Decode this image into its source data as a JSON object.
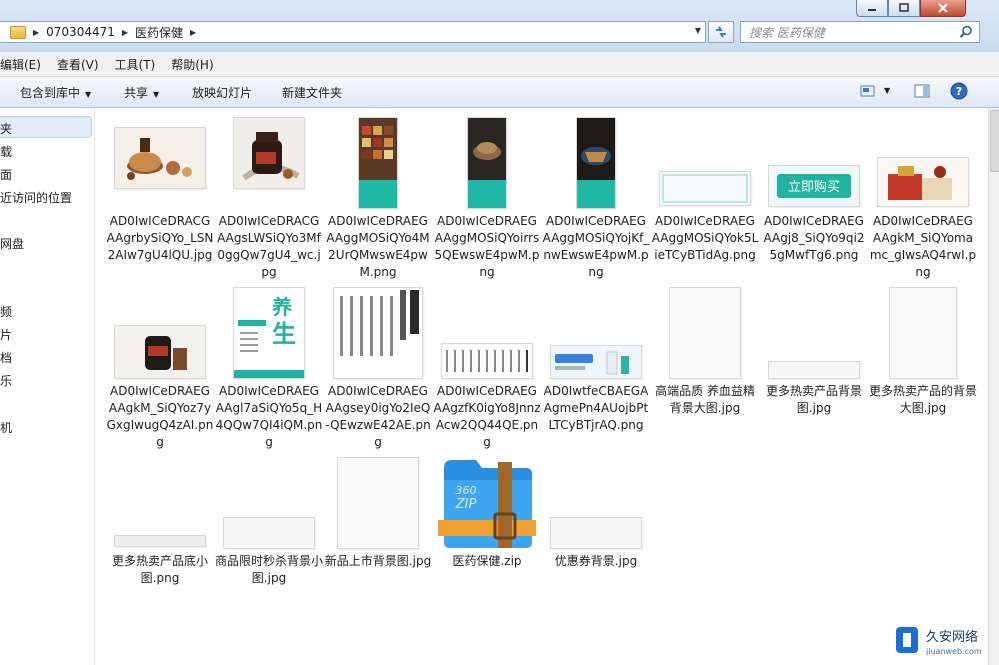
{
  "window": {
    "controls": [
      {
        "name": "minimize-button",
        "glyph": "—"
      },
      {
        "name": "maximize-button",
        "glyph": "▢"
      },
      {
        "name": "close-button",
        "glyph": "✕"
      }
    ]
  },
  "address": {
    "crumbs": [
      "070304471",
      "医药保健"
    ]
  },
  "search": {
    "placeholder": "搜索 医药保健"
  },
  "menu": {
    "items": [
      "编辑(E)",
      "查看(V)",
      "工具(T)",
      "帮助(H)"
    ]
  },
  "toolbar": {
    "include_library": "包含到库中",
    "share": "共享",
    "slideshow": "放映幻灯片",
    "new_folder": "新建文件夹"
  },
  "nav": {
    "items": [
      "夹",
      "载",
      "面",
      "近访问的位置",
      "网盘",
      "频",
      "片",
      "档",
      "乐",
      "机"
    ]
  },
  "files": [
    {
      "name": "AD0IwICeDRACGAAgrbySiQYo_LSN2AIw7gU4lQU.jpg",
      "thumb": "herbs-tea"
    },
    {
      "name": "AD0IwICeDRACGAAgsLWSiQYo3Mf0ggQw7gU4_wc.jpg",
      "thumb": "jar"
    },
    {
      "name": "AD0IwICeDRAEGAAggMOSiQYo4M2UrQMwswE4pwM.png",
      "thumb": "tall-herbs"
    },
    {
      "name": "AD0IwICeDRAEGAAggMOSiQYoirrs5QEwswE4pwM.png",
      "thumb": "tall-dark"
    },
    {
      "name": "AD0IwICeDRAEGAAggMOSiQYojKf_nwEwswE4pwM.png",
      "thumb": "tall-plate"
    },
    {
      "name": "AD0IwICeDRAEGAAggMOSiQYok5LieTCyBTidAg.png",
      "thumb": "banner-light"
    },
    {
      "name": "AD0IwICeDRAEGAAgj8_SiQYo9qi25gMwfTg6.png",
      "thumb": "buy-button"
    },
    {
      "name": "AD0IwICeDRAEGAAgkM_SiQYomamc_gIwsAQ4rwI.png",
      "thumb": "gift-box"
    },
    {
      "name": "AD0IwICeDRAEGAAgkM_SiQYoz7yGxgIwugQ4zAI.png",
      "thumb": "black-jar"
    },
    {
      "name": "AD0IwICeDRAEGAAgl7aSiQYo5q_H4QQw7QI4iQM.png",
      "thumb": "yangsheng"
    },
    {
      "name": "AD0IwICeDRAEGAAgsey0igYo2IeQ-QEwzwE42AE.png",
      "thumb": "vertical-text"
    },
    {
      "name": "AD0IwICeDRAEGAAgzfK0igYo8JnnzAcw2QQ44QE.png",
      "thumb": "text-table"
    },
    {
      "name": "AD0IwtfeCBAEGAAgmePn4AUojbPtLTCyBTjrAQ.png",
      "thumb": "pharmacy-banner"
    },
    {
      "name": "高端品质 养血益精背景大图.jpg",
      "thumb": "blank-tall"
    },
    {
      "name": "更多热卖产品背景图.jpg",
      "thumb": "blank-strip"
    },
    {
      "name": "更多热卖产品的背景大图.jpg",
      "thumb": "blank-sq"
    },
    {
      "name": "更多热卖产品底小图.png",
      "thumb": "thin-strip"
    },
    {
      "name": "商品限时秒杀背景小图.jpg",
      "thumb": "blank-wide"
    },
    {
      "name": "新品上市背景图.jpg",
      "thumb": "blank-tall2"
    },
    {
      "name": "医药保健.zip",
      "thumb": "zip"
    },
    {
      "name": "优惠券背景.jpg",
      "thumb": "blank-wide2"
    }
  ],
  "zip_icon_text": "360 ZIP",
  "watermark": {
    "brand": "久安网络",
    "url": "jiuanweb.com"
  },
  "colors": {
    "accent": "#2c6fb8",
    "teal": "#1fb8a6",
    "zip_blue": "#2a8fe0",
    "zip_strap": "#a0672a"
  }
}
